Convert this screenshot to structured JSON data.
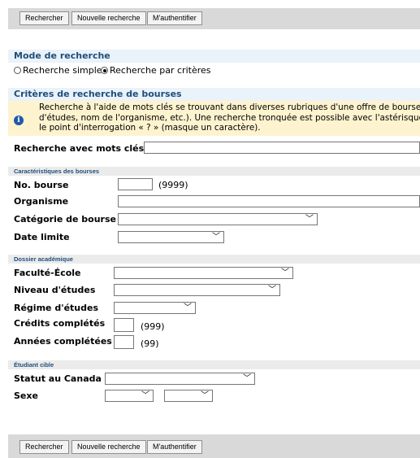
{
  "toolbar": {
    "search": "Rechercher",
    "new_search": "Nouvelle recherche",
    "login": "M'authentifier"
  },
  "mode": {
    "title": "Mode de recherche",
    "simple": "Recherche simple",
    "criteria": "Recherche par critères",
    "selected": "criteria"
  },
  "criteria": {
    "title": "Critères de recherche de bourses",
    "info_line1": "Recherche à l'aide de mots clés se trouvant dans diverses rubriques d'une offre de bourse",
    "info_line2": "d'études, nom de l'organisme, etc.). Une recherche tronquée est possible avec l'astérisque",
    "info_line3": "le point d'interrogation « ? » (masque un caractère).",
    "keywords_label": "Recherche avec mots clés",
    "keywords_value": ""
  },
  "bourses": {
    "title": "Caractéristiques des bourses",
    "number_label": "No. bourse",
    "number_value": "",
    "number_hint": "(9999)",
    "org_label": "Organisme",
    "org_value": "",
    "category_label": "Catégorie de bourse",
    "category_value": "",
    "deadline_label": "Date limite",
    "deadline_value": ""
  },
  "academic": {
    "title": "Dossier académique",
    "faculty_label": "Faculté-École",
    "faculty_value": "",
    "level_label": "Niveau d'études",
    "level_value": "",
    "regime_label": "Régime d'études",
    "regime_value": "",
    "credits_label": "Crédits complétés",
    "credits_value": "",
    "credits_hint": "(999)",
    "years_label": "Années complétées",
    "years_value": "",
    "years_hint": "(99)"
  },
  "student": {
    "title": "Étudiant cible",
    "status_label": "Statut au Canada",
    "status_value": "",
    "sex_label": "Sexe",
    "sex_value_1": "",
    "sex_value_2": ""
  },
  "icons": {
    "info": "info-icon",
    "chevron": "chevron-down-icon"
  },
  "colors": {
    "section_title": "#1f4e79",
    "section_bar": "#eaf2fa",
    "info_bg": "#fdf3cf",
    "toolbar": "#d9d9d9"
  }
}
